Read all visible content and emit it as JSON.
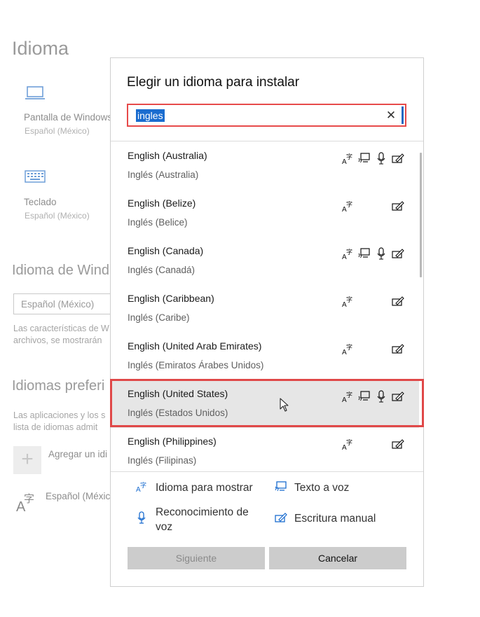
{
  "background": {
    "title": "Idioma",
    "display_label": "Pantalla de Windows",
    "display_sub": "Español (México)",
    "keyboard_label": "Teclado",
    "keyboard_sub": "Español (México)",
    "section_windows": "Idioma de Wind",
    "windows_select": "Español (México)",
    "windows_para_1": "Las características de W",
    "windows_para_2": "archivos, se mostrarán",
    "section_preferred": "Idiomas preferi",
    "preferred_para_1": "Las aplicaciones y los s",
    "preferred_para_2": "lista de idiomas admit",
    "add_language": "Agregar un idi",
    "pref_lang": "Español (Méxic"
  },
  "dialog": {
    "title": "Elegir un idioma para instalar",
    "search_value": "ingles",
    "clear_glyph": "✕",
    "languages": [
      {
        "name": "English (Australia)",
        "native": "Inglés (Australia)",
        "features": [
          "display-language",
          "text-to-speech",
          "speech-recognition",
          "handwriting"
        ]
      },
      {
        "name": "English (Belize)",
        "native": "Inglés (Belice)",
        "features": [
          "display-language",
          "handwriting"
        ]
      },
      {
        "name": "English (Canada)",
        "native": "Inglés (Canadá)",
        "features": [
          "display-language",
          "text-to-speech",
          "speech-recognition",
          "handwriting"
        ]
      },
      {
        "name": "English (Caribbean)",
        "native": "Inglés (Caribe)",
        "features": [
          "display-language",
          "handwriting"
        ]
      },
      {
        "name": "English (United Arab Emirates)",
        "native": "Inglés (Emiratos Árabes Unidos)",
        "features": [
          "display-language",
          "handwriting"
        ]
      },
      {
        "name": "English (United States)",
        "native": "Inglés (Estados Unidos)",
        "features": [
          "display-language",
          "text-to-speech",
          "speech-recognition",
          "handwriting"
        ],
        "selected": true
      },
      {
        "name": "English (Philippines)",
        "native": "Inglés (Filipinas)",
        "features": [
          "display-language",
          "handwriting"
        ]
      }
    ],
    "legend": {
      "display_language": "Idioma para mostrar",
      "text_to_speech": "Texto a voz",
      "speech_recognition_1": "Reconocimiento de",
      "speech_recognition_2": "voz",
      "handwriting": "Escritura manual"
    },
    "buttons": {
      "next": "Siguiente",
      "cancel": "Cancelar"
    },
    "colors": {
      "accent": "#1a6ccf",
      "highlight_outline": "#e04848",
      "selected_row": "#e6e6e6"
    }
  }
}
